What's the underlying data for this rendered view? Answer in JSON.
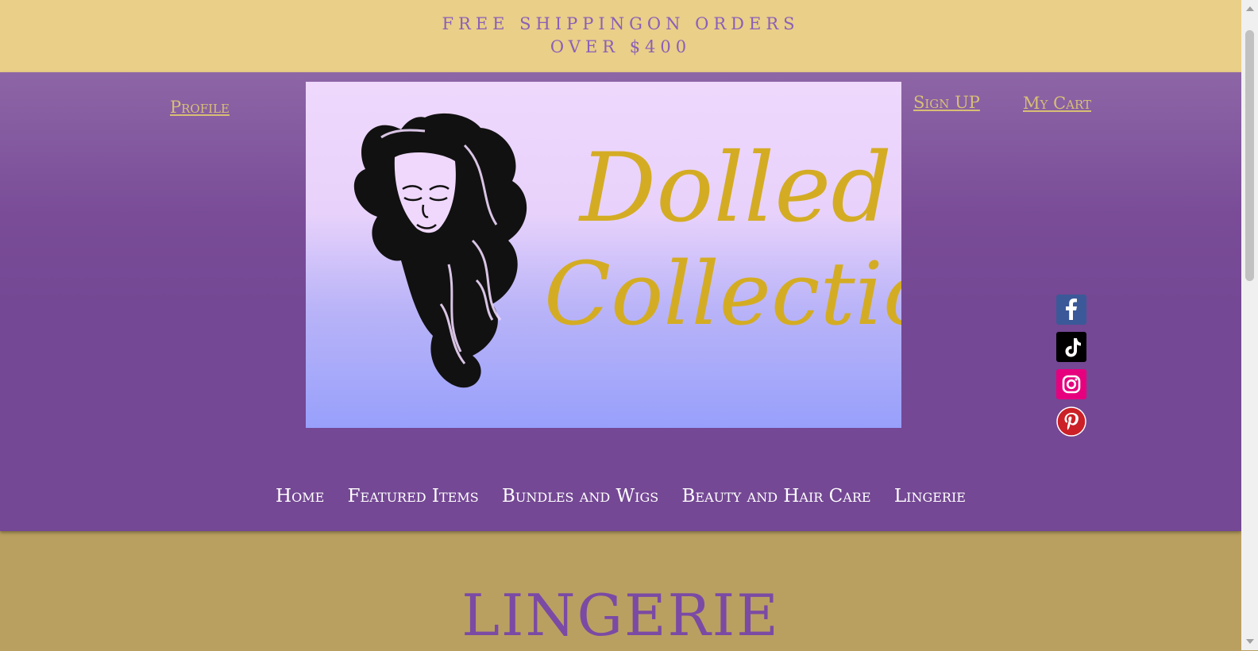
{
  "announcement": {
    "line1": "FREE SHIPPINGON ORDERS",
    "line2": "OVER $400"
  },
  "header": {
    "profile_label": "Profile",
    "signup_label": "Sign UP",
    "cart_label": "My Cart",
    "logo": {
      "line1": "Dolled",
      "line2": "Collection"
    }
  },
  "social": [
    {
      "name": "Facebook",
      "icon": "facebook-icon",
      "color": "#3b5998"
    },
    {
      "name": "TikTok",
      "icon": "tiktok-icon",
      "color": "#000000"
    },
    {
      "name": "Instagram",
      "icon": "instagram-icon",
      "color": "#e6007e"
    },
    {
      "name": "Pinterest",
      "icon": "pinterest-icon",
      "color": "#cb2027"
    }
  ],
  "nav": {
    "items": [
      "Home",
      "Featured Items",
      "Bundles and Wigs",
      "Beauty and Hair Care",
      "Lingerie"
    ]
  },
  "page": {
    "title": "LINGERIE"
  },
  "colors": {
    "announcement_bg": "#e9cf88",
    "header_purple": "#744894",
    "accent_gold": "#d8bf75",
    "content_bg": "#b9a060",
    "title_purple": "#7b4aa4"
  }
}
